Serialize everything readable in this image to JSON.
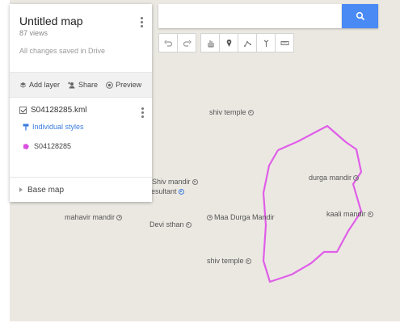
{
  "panel": {
    "title": "Untitled map",
    "views": "87 views",
    "save_status": "All changes saved in Drive",
    "actions": {
      "add_layer": "Add layer",
      "share": "Share",
      "preview": "Preview"
    },
    "layer": {
      "name": "S04128285.kml",
      "style_link": "Individual styles",
      "feature": "S04128285"
    },
    "base_map": "Base map"
  },
  "search": {
    "placeholder": "",
    "icon": "search-icon"
  },
  "toolbar": {
    "icons": [
      "undo-icon",
      "redo-icon",
      "hand-icon",
      "marker-icon",
      "draw-line-icon",
      "directions-icon",
      "measure-icon"
    ]
  },
  "map_labels": {
    "shiv_temple_top": "shiv temple",
    "shiv_mandir": "Shiv mandir",
    "resultant": "resultant",
    "mahavir_mandir": "mahavir mandir",
    "devi_sthan": "Devi sthan",
    "maa_durga_mandir": "Maa Durga Mandir",
    "shiv_temple_bottom": "shiv temple",
    "durga_mandir": "durga mandir",
    "kaali_mandir": "kaali mandir"
  },
  "colors": {
    "accent": "#4a8af4",
    "boundary": "#e05ee8",
    "map_bg": "#ebe8e2",
    "link": "#3a7be0"
  }
}
